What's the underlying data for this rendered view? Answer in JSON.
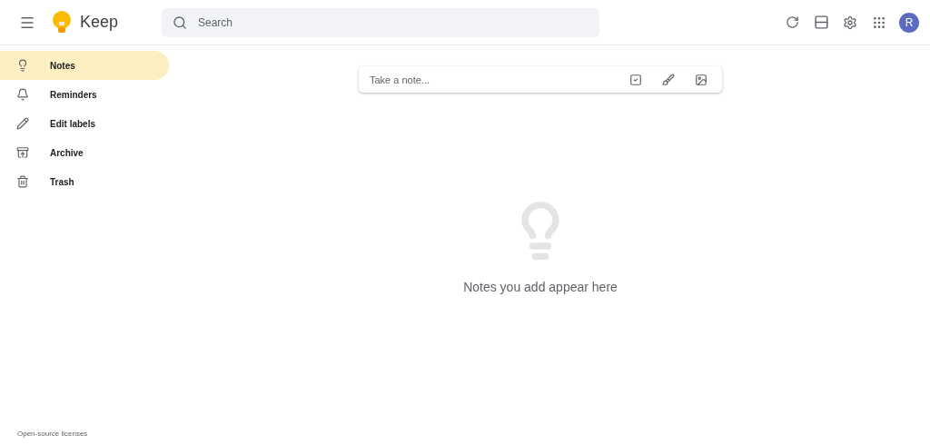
{
  "header": {
    "app_name": "Keep",
    "search": {
      "placeholder": "Search"
    },
    "avatar": "R"
  },
  "sidebar": {
    "items": [
      {
        "kind": "notes",
        "label": "Notes",
        "selected": true
      },
      {
        "kind": "reminders",
        "label": "Reminders",
        "selected": false
      },
      {
        "kind": "labels",
        "label": "Edit labels",
        "selected": false
      },
      {
        "kind": "archive",
        "label": "Archive",
        "selected": false
      },
      {
        "kind": "trash",
        "label": "Trash",
        "selected": false
      }
    ],
    "footer": "Open-source licenses"
  },
  "note_input": {
    "placeholder": "Take a note..."
  },
  "empty_state": "Notes you add appear here"
}
